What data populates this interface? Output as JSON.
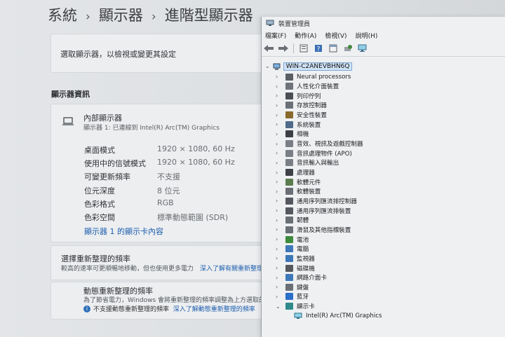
{
  "settings": {
    "breadcrumb": [
      "系統",
      "顯示器",
      "進階型顯示器"
    ],
    "select_display_label": "選取顯示器，以檢視或變更其設定",
    "section_title": "顯示器資訊",
    "display": {
      "name": "內部顯示器",
      "subtitle": "顯示器 1: 已連線到 Intel(R) Arc(TM) Graphics",
      "specs": [
        {
          "key": "桌面模式",
          "value": "1920 × 1080, 60 Hz"
        },
        {
          "key": "使用中的信號模式",
          "value": "1920 × 1080, 60 Hz"
        },
        {
          "key": "可變更新頻率",
          "value": "不支援"
        },
        {
          "key": "位元深度",
          "value": "8 位元"
        },
        {
          "key": "色彩格式",
          "value": "RGB"
        },
        {
          "key": "色彩空間",
          "value": "標準動態範圍 (SDR)"
        }
      ],
      "adapter_link": "顯示器 1 的顯示卡內容"
    },
    "refresh": {
      "title": "選擇重新整理的頻率",
      "desc": "較高的速率可更順暢地移動，但也使用更多電力",
      "learn_more": "深入了解有關重新整理",
      "dynamic_title": "動態重新整理的頻率",
      "dynamic_desc": "為了節省電力，Windows 會將重新整理的頻率調整為上方選取的",
      "unsupported": "不支援動態重新整理的頻率",
      "unsupported_link": "深入了解動態重新整理的頻率"
    }
  },
  "device_manager": {
    "title": "裝置管理員",
    "menu": [
      "檔案(F)",
      "動作(A)",
      "檢視(V)",
      "說明(H)"
    ],
    "root": "WIN-C2ANEVBHN6Q",
    "categories": [
      {
        "label": "Neural processors",
        "color": "#5a5f66"
      },
      {
        "label": "人性化介面裝置",
        "color": "#6f747a"
      },
      {
        "label": "列印佇列",
        "color": "#4b4f55"
      },
      {
        "label": "存放控制器",
        "color": "#6b7077"
      },
      {
        "label": "安全性裝置",
        "color": "#8a6a2b"
      },
      {
        "label": "系統裝置",
        "color": "#4f6b8a"
      },
      {
        "label": "相機",
        "color": "#3c3f44"
      },
      {
        "label": "音效、視訊及遊戲控制器",
        "color": "#7a7f86"
      },
      {
        "label": "音訊處理物件 (APO)",
        "color": "#7a7f86"
      },
      {
        "label": "音訊輸入與輸出",
        "color": "#7a7f86"
      },
      {
        "label": "處理器",
        "color": "#3f4349"
      },
      {
        "label": "軟體元件",
        "color": "#5b7c4f"
      },
      {
        "label": "軟體裝置",
        "color": "#6a6f76"
      },
      {
        "label": "通用序列匯流排控制器",
        "color": "#55595f"
      },
      {
        "label": "通用序列匯流排裝置",
        "color": "#55595f"
      },
      {
        "label": "韌體",
        "color": "#6a6f76"
      },
      {
        "label": "滑鼠及其他指標裝置",
        "color": "#6a6f76"
      },
      {
        "label": "電池",
        "color": "#3f8a3c"
      },
      {
        "label": "電腦",
        "color": "#3d78b8"
      },
      {
        "label": "監視器",
        "color": "#3d78b8"
      },
      {
        "label": "磁碟機",
        "color": "#55595f"
      },
      {
        "label": "網路介面卡",
        "color": "#3d78b8"
      },
      {
        "label": "鍵盤",
        "color": "#6a6f76"
      },
      {
        "label": "藍牙",
        "color": "#2a6fc9"
      },
      {
        "label": "顯示卡",
        "color": "#2f8a8a",
        "expanded": true
      }
    ],
    "child": "Intel(R) Arc(TM) Graphics",
    "colors": {
      "selection_bg": "#cfe2f7",
      "link": "#1f5fae"
    }
  }
}
